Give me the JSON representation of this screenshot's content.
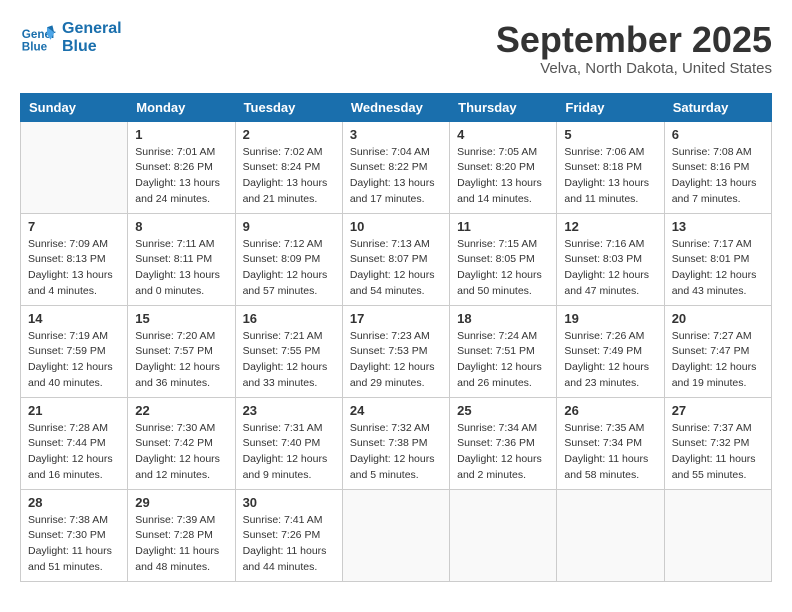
{
  "header": {
    "logo_line1": "General",
    "logo_line2": "Blue",
    "month_title": "September 2025",
    "location": "Velva, North Dakota, United States"
  },
  "weekdays": [
    "Sunday",
    "Monday",
    "Tuesday",
    "Wednesday",
    "Thursday",
    "Friday",
    "Saturday"
  ],
  "weeks": [
    [
      {
        "day": "",
        "info": ""
      },
      {
        "day": "1",
        "info": "Sunrise: 7:01 AM\nSunset: 8:26 PM\nDaylight: 13 hours\nand 24 minutes."
      },
      {
        "day": "2",
        "info": "Sunrise: 7:02 AM\nSunset: 8:24 PM\nDaylight: 13 hours\nand 21 minutes."
      },
      {
        "day": "3",
        "info": "Sunrise: 7:04 AM\nSunset: 8:22 PM\nDaylight: 13 hours\nand 17 minutes."
      },
      {
        "day": "4",
        "info": "Sunrise: 7:05 AM\nSunset: 8:20 PM\nDaylight: 13 hours\nand 14 minutes."
      },
      {
        "day": "5",
        "info": "Sunrise: 7:06 AM\nSunset: 8:18 PM\nDaylight: 13 hours\nand 11 minutes."
      },
      {
        "day": "6",
        "info": "Sunrise: 7:08 AM\nSunset: 8:16 PM\nDaylight: 13 hours\nand 7 minutes."
      }
    ],
    [
      {
        "day": "7",
        "info": "Sunrise: 7:09 AM\nSunset: 8:13 PM\nDaylight: 13 hours\nand 4 minutes."
      },
      {
        "day": "8",
        "info": "Sunrise: 7:11 AM\nSunset: 8:11 PM\nDaylight: 13 hours\nand 0 minutes."
      },
      {
        "day": "9",
        "info": "Sunrise: 7:12 AM\nSunset: 8:09 PM\nDaylight: 12 hours\nand 57 minutes."
      },
      {
        "day": "10",
        "info": "Sunrise: 7:13 AM\nSunset: 8:07 PM\nDaylight: 12 hours\nand 54 minutes."
      },
      {
        "day": "11",
        "info": "Sunrise: 7:15 AM\nSunset: 8:05 PM\nDaylight: 12 hours\nand 50 minutes."
      },
      {
        "day": "12",
        "info": "Sunrise: 7:16 AM\nSunset: 8:03 PM\nDaylight: 12 hours\nand 47 minutes."
      },
      {
        "day": "13",
        "info": "Sunrise: 7:17 AM\nSunset: 8:01 PM\nDaylight: 12 hours\nand 43 minutes."
      }
    ],
    [
      {
        "day": "14",
        "info": "Sunrise: 7:19 AM\nSunset: 7:59 PM\nDaylight: 12 hours\nand 40 minutes."
      },
      {
        "day": "15",
        "info": "Sunrise: 7:20 AM\nSunset: 7:57 PM\nDaylight: 12 hours\nand 36 minutes."
      },
      {
        "day": "16",
        "info": "Sunrise: 7:21 AM\nSunset: 7:55 PM\nDaylight: 12 hours\nand 33 minutes."
      },
      {
        "day": "17",
        "info": "Sunrise: 7:23 AM\nSunset: 7:53 PM\nDaylight: 12 hours\nand 29 minutes."
      },
      {
        "day": "18",
        "info": "Sunrise: 7:24 AM\nSunset: 7:51 PM\nDaylight: 12 hours\nand 26 minutes."
      },
      {
        "day": "19",
        "info": "Sunrise: 7:26 AM\nSunset: 7:49 PM\nDaylight: 12 hours\nand 23 minutes."
      },
      {
        "day": "20",
        "info": "Sunrise: 7:27 AM\nSunset: 7:47 PM\nDaylight: 12 hours\nand 19 minutes."
      }
    ],
    [
      {
        "day": "21",
        "info": "Sunrise: 7:28 AM\nSunset: 7:44 PM\nDaylight: 12 hours\nand 16 minutes."
      },
      {
        "day": "22",
        "info": "Sunrise: 7:30 AM\nSunset: 7:42 PM\nDaylight: 12 hours\nand 12 minutes."
      },
      {
        "day": "23",
        "info": "Sunrise: 7:31 AM\nSunset: 7:40 PM\nDaylight: 12 hours\nand 9 minutes."
      },
      {
        "day": "24",
        "info": "Sunrise: 7:32 AM\nSunset: 7:38 PM\nDaylight: 12 hours\nand 5 minutes."
      },
      {
        "day": "25",
        "info": "Sunrise: 7:34 AM\nSunset: 7:36 PM\nDaylight: 12 hours\nand 2 minutes."
      },
      {
        "day": "26",
        "info": "Sunrise: 7:35 AM\nSunset: 7:34 PM\nDaylight: 11 hours\nand 58 minutes."
      },
      {
        "day": "27",
        "info": "Sunrise: 7:37 AM\nSunset: 7:32 PM\nDaylight: 11 hours\nand 55 minutes."
      }
    ],
    [
      {
        "day": "28",
        "info": "Sunrise: 7:38 AM\nSunset: 7:30 PM\nDaylight: 11 hours\nand 51 minutes."
      },
      {
        "day": "29",
        "info": "Sunrise: 7:39 AM\nSunset: 7:28 PM\nDaylight: 11 hours\nand 48 minutes."
      },
      {
        "day": "30",
        "info": "Sunrise: 7:41 AM\nSunset: 7:26 PM\nDaylight: 11 hours\nand 44 minutes."
      },
      {
        "day": "",
        "info": ""
      },
      {
        "day": "",
        "info": ""
      },
      {
        "day": "",
        "info": ""
      },
      {
        "day": "",
        "info": ""
      }
    ]
  ]
}
